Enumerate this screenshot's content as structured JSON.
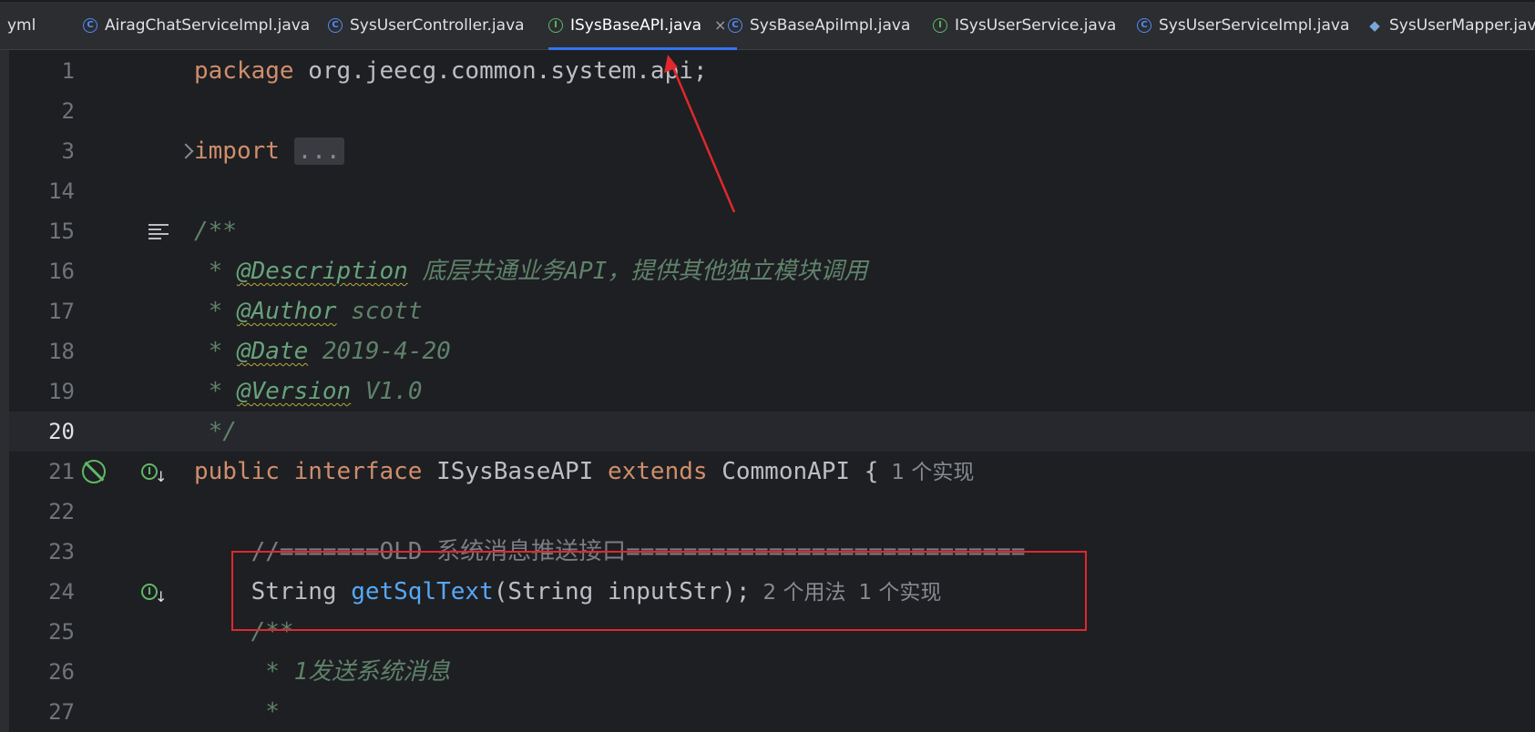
{
  "tabs": [
    {
      "label": "yml",
      "icon": "none"
    },
    {
      "label": "AiragChatServiceImpl.java",
      "icon": "class-icon"
    },
    {
      "label": "SysUserController.java",
      "icon": "class-icon"
    },
    {
      "label": "ISysBaseAPI.java",
      "icon": "interface-icon",
      "active": true,
      "close": "×"
    },
    {
      "label": "SysBaseApiImpl.java",
      "icon": "class-icon"
    },
    {
      "label": "ISysUserService.java",
      "icon": "interface-icon"
    },
    {
      "label": "SysUserServiceImpl.java",
      "icon": "class-icon"
    },
    {
      "label": "SysUserMapper.java",
      "icon": "mapper-icon"
    }
  ],
  "editor": {
    "current_line": "20",
    "lines": [
      {
        "num": "1",
        "kw": "package",
        "text": " org.jeecg.common.system.api;"
      },
      {
        "num": "2"
      },
      {
        "num": "3",
        "kw": "import",
        "fold": "..."
      },
      {
        "num": "14"
      },
      {
        "num": "15",
        "doc": "/**"
      },
      {
        "num": "16",
        "star": " * ",
        "tag": "@Description",
        "value": " 底层共通业务API，提供其他独立模块调用"
      },
      {
        "num": "17",
        "star": " * ",
        "tag": "@Author",
        "value": " scott"
      },
      {
        "num": "18",
        "star": " * ",
        "tag": "@Date",
        "value": " 2019-4-20"
      },
      {
        "num": "19",
        "star": " * ",
        "tag": "@Version",
        "value": " V1.0"
      },
      {
        "num": "20",
        "doc": " */"
      },
      {
        "num": "21",
        "kw1": "public",
        "kw2": "interface",
        "name": "ISysBaseAPI",
        "kw3": "extends",
        "parent": "CommonAPI {",
        "hint": "1 个实现"
      },
      {
        "num": "22"
      },
      {
        "num": "23",
        "comment": "    //=======OLD 系统消息推送接口============================"
      },
      {
        "num": "24",
        "type": "    String ",
        "fn": "getSqlText",
        "args": "(String inputStr);",
        "hint1": "2 个用法",
        "hint2": "1 个实现"
      },
      {
        "num": "25",
        "doc": "    /**"
      },
      {
        "num": "26",
        "doc": "     * 1发送系统消息"
      },
      {
        "num": "27",
        "doc": "     *"
      }
    ]
  },
  "gutter_icons": {
    "implemented_glyph": "I",
    "implemented_arrow": "↓"
  },
  "colors": {
    "annotation": "#e0282d",
    "keyword": "#cf8e6d",
    "doc": "#5f826b",
    "function": "#56a8f5"
  }
}
